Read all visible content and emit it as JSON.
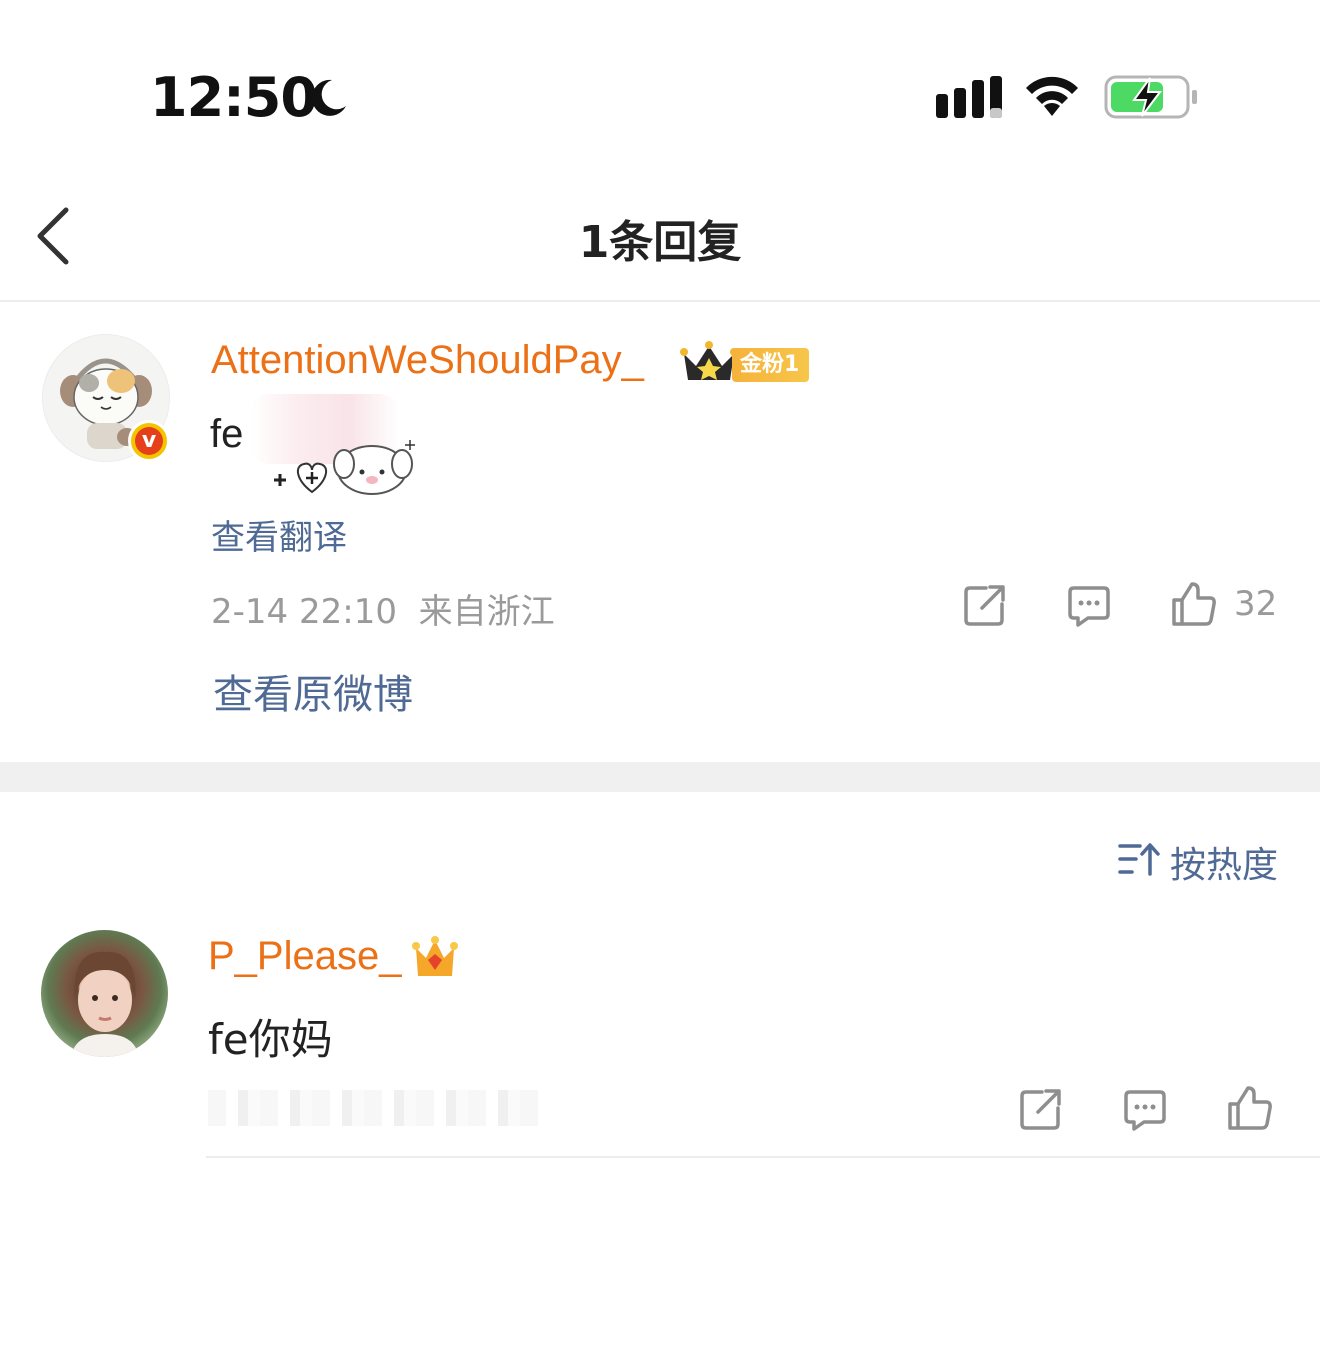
{
  "status_bar": {
    "time": "12:50"
  },
  "header": {
    "title": "1条回复"
  },
  "main_comment": {
    "username": "AttentionWeShouldPay_",
    "fan_badge": "金粉1",
    "text": "fe",
    "translate_label": "查看翻译",
    "timestamp": "2-14 22:10",
    "location": "来自浙江",
    "likes": "32",
    "view_original_label": "查看原微博"
  },
  "sort": {
    "label": "按热度"
  },
  "replies": [
    {
      "username": "P_Please_",
      "text": "fe你妈"
    }
  ],
  "colors": {
    "username": "#eb7016",
    "link": "#4f6a94",
    "meta": "#9a9a9a",
    "battery_fill": "#4cd964"
  }
}
